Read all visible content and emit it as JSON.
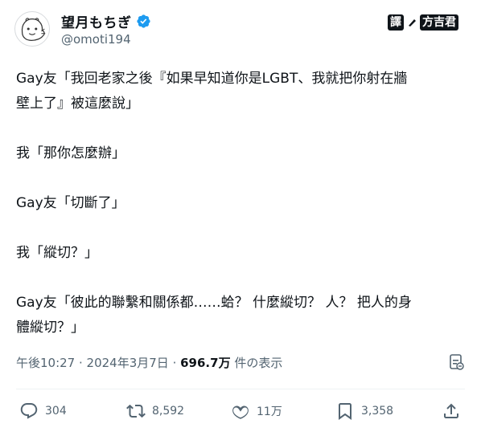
{
  "author": {
    "display_name": "望月もちぎ",
    "handle": "@omoti194",
    "avatar_icon": "cartoon-avatar-icon",
    "verified_icon": "verified-badge-icon",
    "verified_color": "#1d9bf0"
  },
  "watermark": {
    "box_text": "譯",
    "name": "方吉君"
  },
  "tweet": {
    "lines": [
      "Gay友「我回老家之後『如果早知道你是LGBT、我就把你射在牆",
      "壁上了』被這麼說」",
      "",
      "我「那你怎麼辦」",
      "",
      "Gay友「切斷了」",
      "",
      "我「縱切？」",
      "",
      "Gay友「彼此的聯繫和關係都……蛤？ 什麼縱切？ 人？ 把人的身",
      "體縱切？」"
    ]
  },
  "meta": {
    "time": "午後10:27",
    "separator": " · ",
    "date": "2024年3月7日",
    "views": "696.7万",
    "views_label": " 件の表示"
  },
  "actions": {
    "reply_count": "304",
    "retweet_count": "8,592",
    "like_count": "11万",
    "bookmark_count": "3,358"
  },
  "colors": {
    "text": "#0f1419",
    "secondary": "#536471",
    "accent": "#1d9bf0"
  }
}
